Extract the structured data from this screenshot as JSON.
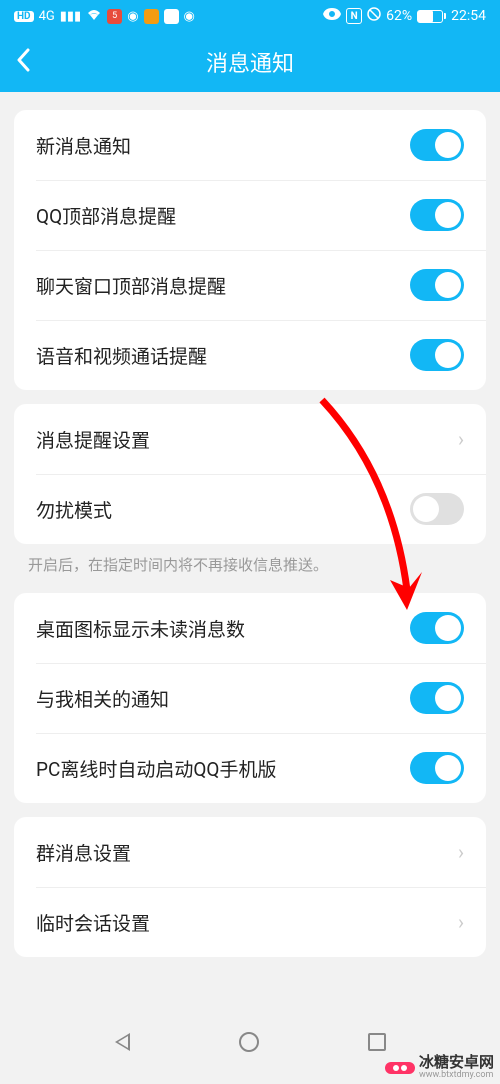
{
  "statusBar": {
    "hd": "HD",
    "signal4G": "4G",
    "battery_pct": "62%",
    "time": "22:54"
  },
  "header": {
    "title": "消息通知"
  },
  "groups": [
    {
      "rows": [
        {
          "label": "新消息通知",
          "type": "toggle",
          "on": true
        },
        {
          "label": "QQ顶部消息提醒",
          "type": "toggle",
          "on": true
        },
        {
          "label": "聊天窗口顶部消息提醒",
          "type": "toggle",
          "on": true
        },
        {
          "label": "语音和视频通话提醒",
          "type": "toggle",
          "on": true
        }
      ]
    },
    {
      "rows": [
        {
          "label": "消息提醒设置",
          "type": "nav"
        },
        {
          "label": "勿扰模式",
          "type": "toggle",
          "on": false
        }
      ],
      "helper": "开启后，在指定时间内将不再接收信息推送。"
    },
    {
      "rows": [
        {
          "label": "桌面图标显示未读消息数",
          "type": "toggle",
          "on": true
        },
        {
          "label": "与我相关的通知",
          "type": "toggle",
          "on": true
        },
        {
          "label": "PC离线时自动启动QQ手机版",
          "type": "toggle",
          "on": true
        }
      ]
    },
    {
      "rows": [
        {
          "label": "群消息设置",
          "type": "nav"
        },
        {
          "label": "临时会话设置",
          "type": "nav"
        }
      ]
    }
  ],
  "watermark": {
    "brand": "冰糖安卓网",
    "url": "www.btxtdmy.com"
  }
}
